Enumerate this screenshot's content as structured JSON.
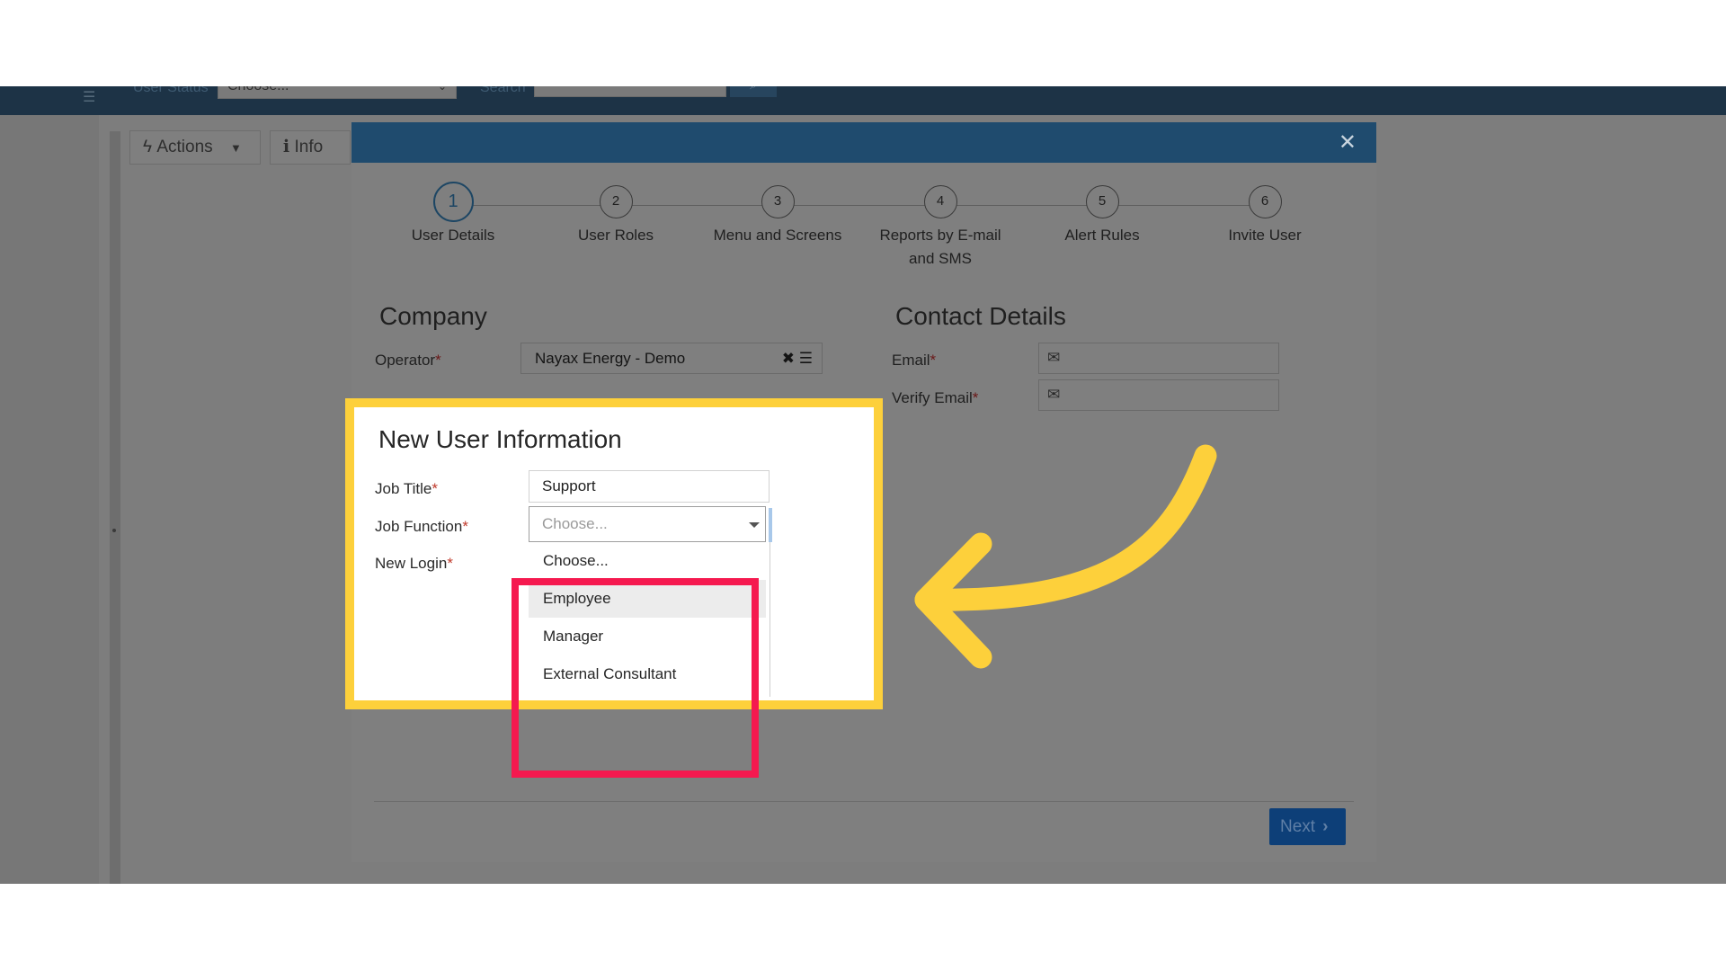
{
  "app_bar": {
    "status_label": "User Status",
    "status_value": "Choose...",
    "search_label": "Search"
  },
  "toolbar": {
    "actions_label": "Actions",
    "info_label": "Info"
  },
  "modal": {
    "close_glyph": "✕",
    "steps": [
      {
        "number": "1",
        "label": "User Details",
        "active": true
      },
      {
        "number": "2",
        "label": "User Roles"
      },
      {
        "number": "3",
        "label": "Menu and Screens"
      },
      {
        "number": "4",
        "label": "Reports by E-mail and SMS"
      },
      {
        "number": "5",
        "label": "Alert Rules"
      },
      {
        "number": "6",
        "label": "Invite User"
      }
    ],
    "company": {
      "title": "Company",
      "operator_label": "Operator",
      "operator_value": "Nayax Energy - Demo"
    },
    "contact": {
      "title": "Contact Details",
      "email_label": "Email",
      "verify_email_label": "Verify Email"
    },
    "new_user": {
      "title": "New User Information",
      "job_title_label": "Job Title",
      "job_title_value": "Support",
      "job_function_label": "Job Function",
      "job_function_placeholder": "Choose...",
      "job_function_options": [
        "Choose...",
        "Employee",
        "Manager",
        "External Consultant"
      ],
      "hovered_option": "Employee",
      "new_login_label": "New Login"
    },
    "next_label": "Next"
  },
  "colors": {
    "callout_yellow": "#fdd03b",
    "highlight_pink": "#f5194f",
    "arrow_yellow": "#fdd03b",
    "header_blue": "#1f4b6e"
  },
  "icons": [
    "list-icon",
    "search-icon",
    "bolt-icon",
    "info-icon",
    "close-icon",
    "clear-icon",
    "mail-icon",
    "chevron-right-icon",
    "caret-down-icon"
  ]
}
